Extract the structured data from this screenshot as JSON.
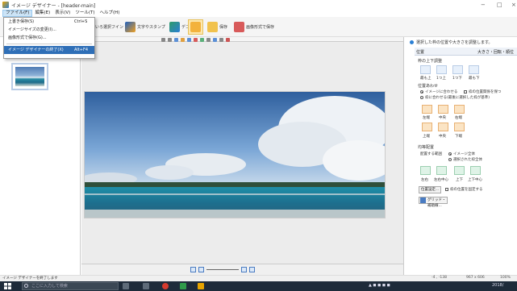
{
  "window": {
    "title": "イメージ デザイナー - [header-main]",
    "min": "−",
    "max": "□",
    "close": "×"
  },
  "menus": [
    "ファイル(F)",
    "編集(E)",
    "表示(V)",
    "ツール(T)",
    "ヘルプ(H)"
  ],
  "toolbar": [
    {
      "label": "",
      "icon": "undo-redo-icon"
    },
    {
      "label": "いろ選択フイン",
      "icon": "palette-icon"
    },
    {
      "label": "文字やスタンプ",
      "icon": "text-A-icon"
    },
    {
      "label": "デコ",
      "icon": "stamp-icon"
    },
    {
      "label": "",
      "icon": "layout-icon",
      "selected": true
    },
    {
      "label": "保存",
      "icon": "folder-save-icon"
    },
    {
      "label": "画像形式で保存",
      "icon": "export-icon"
    }
  ],
  "file_menu": [
    {
      "label": "上書き保存(S)",
      "shortcut": "Ctrl+S"
    },
    {
      "label": "イメージサイズの変更(I)...",
      "shortcut": ""
    },
    {
      "label": "画像形式で保存(G)...",
      "shortcut": ""
    },
    {
      "label": "イメージ デザイナーの終了(X)",
      "shortcut": "Alt+F4",
      "highlighted": true
    }
  ],
  "right_panel": {
    "header": "選択した枠の位置や大きさを調整します。",
    "tabs": [
      "位置",
      "大きさ・回転・順位"
    ],
    "frame_up_down": {
      "heading": "枠の上下調整",
      "buttons": [
        "最も上",
        "1つ上",
        "1つ下",
        "最も下"
      ]
    },
    "align": {
      "heading": "位置あわせ",
      "option1": "イメージに合わせる",
      "check_label": "枠の位置関係を保つ",
      "option2": "枠に合わせる(最後に選択した枠が基準)",
      "row1": [
        "左端",
        "中央",
        "右端"
      ],
      "row2": [
        "上端",
        "中央",
        "下端"
      ]
    },
    "distribute": {
      "heading": "均等配置",
      "label": "配置する範囲",
      "option1": "イメージ全体",
      "option2": "選択された枠全体",
      "row": [
        "左右",
        "左右中心",
        "上下",
        "上下中心"
      ]
    },
    "pos_set_button": "位置設定...",
    "fix_pos_label": "枠の位置を固定する",
    "grid_button": "グリッド・補助線..."
  },
  "status": {
    "text": "イメージ デザイナーを終了します",
    "coords": "-4 , -138",
    "size": "967 x 606",
    "zoom": "100%"
  },
  "taskbar": {
    "search_placeholder": "ここに入力して検索",
    "time": "2018/"
  },
  "colors": {
    "accent": "#2a7fd4",
    "highlight": "#2f6fb7",
    "taskbar": "#1e2b3a",
    "toolbar_sel": "#fde8b0"
  }
}
